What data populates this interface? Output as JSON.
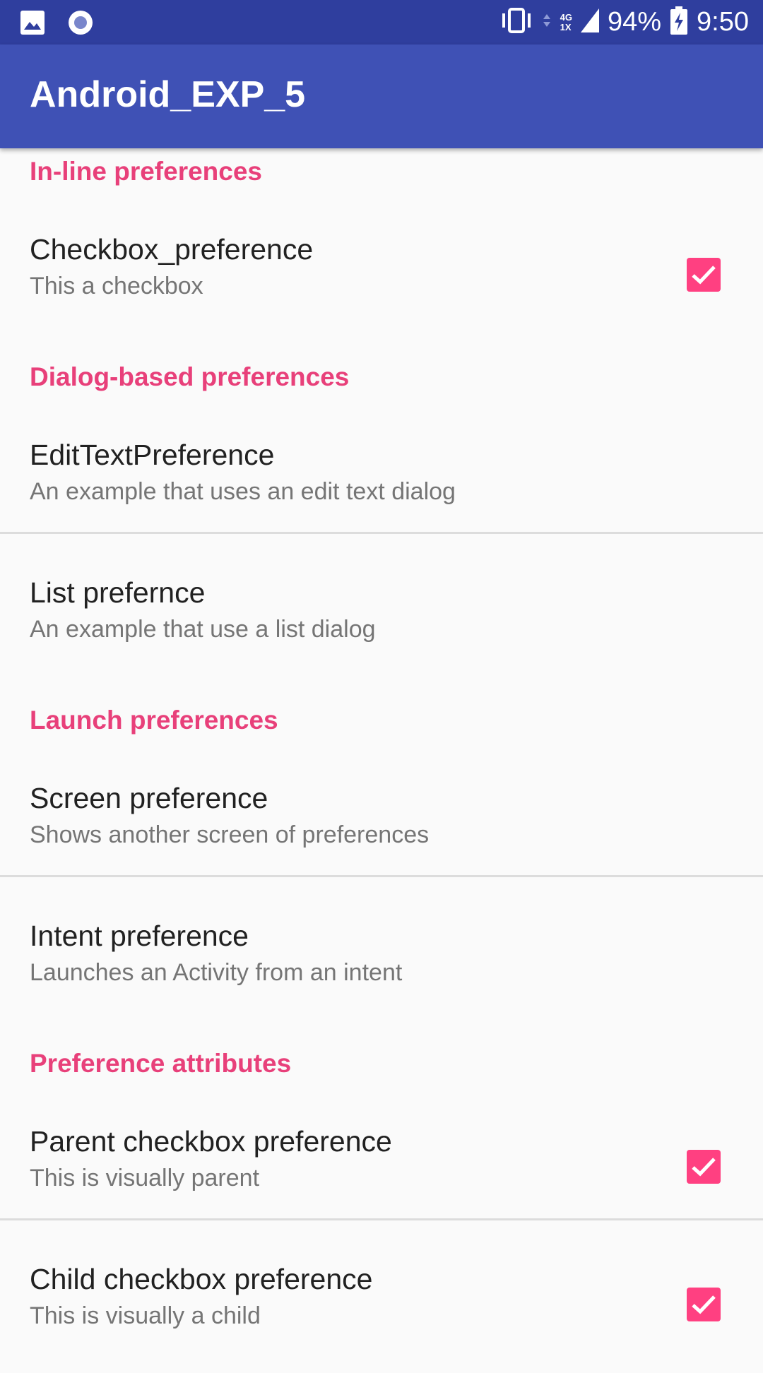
{
  "status_bar": {
    "battery": "94%",
    "time": "9:50",
    "network_top": "4G",
    "network_bottom": "1X",
    "icons": [
      "image-icon",
      "record-icon",
      "vibrate-icon",
      "data-arrows-icon",
      "signal-icon",
      "battery-charging-icon"
    ]
  },
  "app_bar": {
    "title": "Android_EXP_5"
  },
  "categories": {
    "inline": "In-line preferences",
    "dialog": "Dialog-based preferences",
    "launch": "Launch preferences",
    "attributes": "Preference attributes"
  },
  "prefs": {
    "checkbox": {
      "title": "Checkbox_preference",
      "summary": "This a checkbox",
      "checked": true
    },
    "edittext": {
      "title": "EditTextPreference",
      "summary": "An example that uses an edit text dialog"
    },
    "list": {
      "title": "List prefernce",
      "summary": "An example that use a list dialog"
    },
    "screen": {
      "title": "Screen preference",
      "summary": "Shows another screen of preferences"
    },
    "intent": {
      "title": "Intent preference",
      "summary": "Launches an Activity from an intent"
    },
    "parent": {
      "title": "Parent checkbox preference",
      "summary": "This is visually parent",
      "checked": true
    },
    "child": {
      "title": "Child checkbox preference",
      "summary": "This is visually a child",
      "checked": true
    }
  },
  "colors": {
    "status_bar": "#2f3e9e",
    "app_bar": "#3f51b5",
    "accent": "#ff4081",
    "category_text": "#e8407a"
  }
}
